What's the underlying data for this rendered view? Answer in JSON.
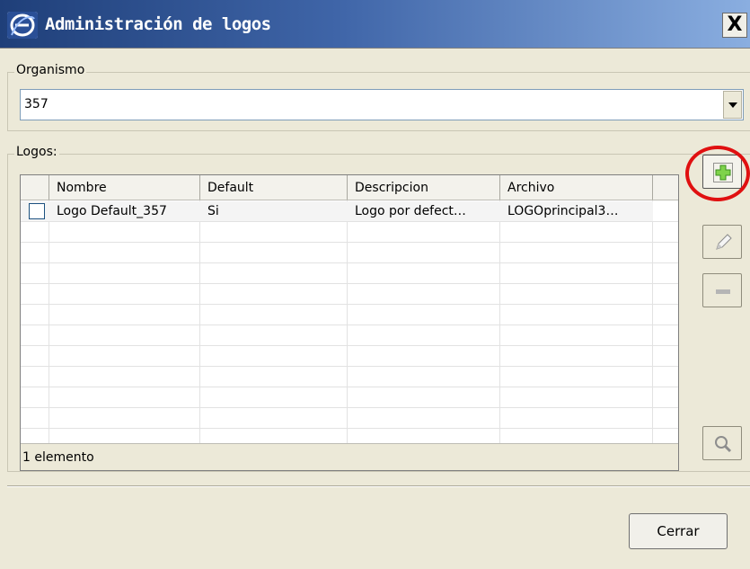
{
  "window": {
    "title": "Administración de logos",
    "close_label": "X",
    "titlebar_color": "#3f65a8"
  },
  "organismo": {
    "label": "Organismo",
    "selected_value": "357"
  },
  "logos": {
    "label": "Logos:",
    "columns": [
      "Nombre",
      "Default",
      "Descripcion",
      "Archivo"
    ],
    "rows": [
      {
        "checked": false,
        "nombre": "Logo Default_357",
        "default": "Si",
        "descripcion": "Logo por defect…",
        "archivo": "LOGOprincipal3…"
      }
    ],
    "status": "1 elemento"
  },
  "side_buttons": {
    "add_icon": "plus-icon",
    "edit_icon": "pencil-icon",
    "remove_icon": "minus-icon",
    "search_icon": "magnifier-icon",
    "highlight_color": "#e01010"
  },
  "footer": {
    "close_button_label": "Cerrar"
  }
}
